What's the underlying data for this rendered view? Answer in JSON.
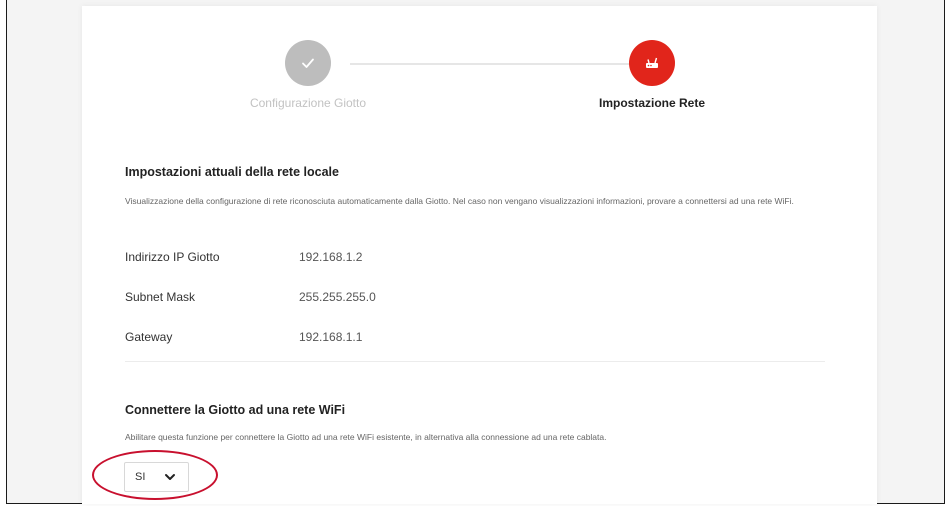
{
  "stepper": {
    "steps": [
      {
        "label": "Configurazione Giotto",
        "icon": "checkmark-icon",
        "state": "completed",
        "color": "#bdbdbd"
      },
      {
        "label": "Impostazione Rete",
        "icon": "router-icon",
        "state": "active",
        "color": "#e1251b"
      }
    ]
  },
  "local_network": {
    "title": "Impostazioni attuali della rete locale",
    "description": "Visualizzazione della configurazione di rete riconosciuta automaticamente dalla Giotto. Nel caso non vengano visualizzazioni informazioni, provare a connettersi ad una rete WiFi.",
    "rows": [
      {
        "label": "Indirizzo IP Giotto",
        "value": "192.168.1.2"
      },
      {
        "label": "Subnet Mask",
        "value": "255.255.255.0"
      },
      {
        "label": "Gateway",
        "value": "192.168.1.1"
      }
    ]
  },
  "wifi": {
    "title": "Connettere la Giotto ad una rete WiFi",
    "description": "Abilitare questa funzione per connettere la Giotto ad una rete WiFi esistente, in alternativa alla connessione ad una rete cablata.",
    "select_value": "SI",
    "highlight_color": "#c8102e"
  }
}
